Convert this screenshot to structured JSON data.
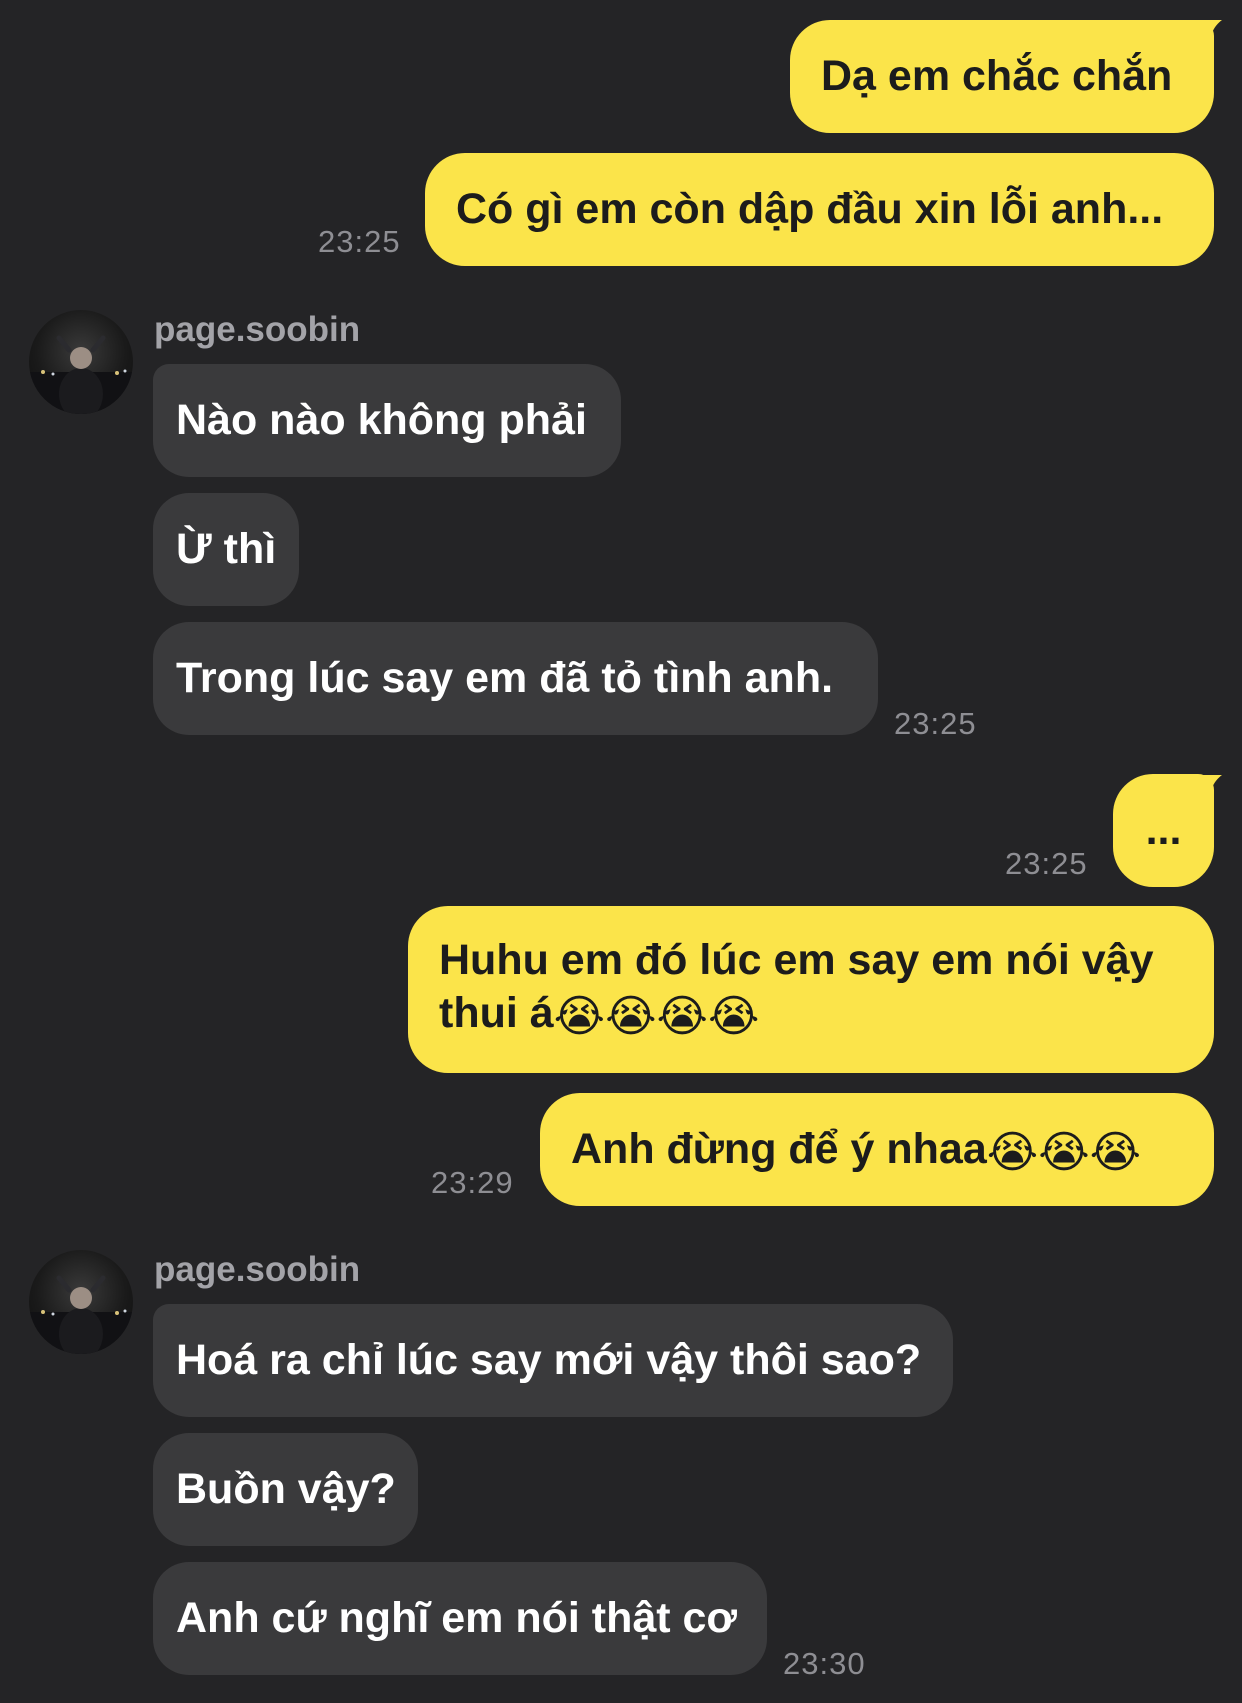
{
  "contact": {
    "username": "page.soobin"
  },
  "messages": {
    "m1": "Dạ em chắc chắn",
    "m2": "Có gì em còn dập đầu xin lỗi anh...",
    "m3": "Nào nào không phải",
    "m4": "Ừ thì",
    "m5": "Trong lúc say em đã tỏ tình anh.",
    "m6": "...",
    "m7": "Huhu em đó lúc em say em nói vậy thui á😭😭😭😭",
    "m8": "Anh đừng để ý nhaa😭😭😭",
    "m9": "Hoá ra chỉ lúc say mới vậy thôi sao?",
    "m10": "Buồn vậy?",
    "m11": "Anh cứ nghĩ em nói thật cơ"
  },
  "timestamps": {
    "t1": "23:25",
    "t2": "23:25",
    "t3": "23:25",
    "t4": "23:29",
    "t5": "23:30"
  },
  "colors": {
    "background": "#242426",
    "sent_bubble": "#fbe44a",
    "received_bubble": "#3a3a3c",
    "timestamp": "#8e8e93"
  },
  "icons": {
    "avatar": "profile-photo-dark",
    "emoji": "loudly-crying-face"
  }
}
